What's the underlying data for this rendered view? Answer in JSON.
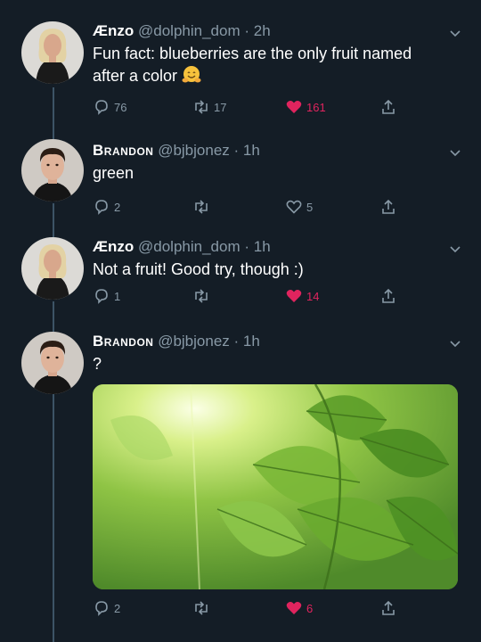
{
  "tweets": [
    {
      "name": "Ænzo",
      "handle": "@dolphin_dom",
      "time": "· 2h",
      "text_a": "Fun fact: blueberries are the only fruit named",
      "text_b": "after a color",
      "emoji": "hugging-face-emoji",
      "replies": "76",
      "retweets": "17",
      "likes": "161",
      "liked": true
    },
    {
      "name": "Brandon",
      "handle": "@bjbjonez",
      "time": "· 1h",
      "text": "green",
      "replies": "2",
      "retweets": "",
      "likes": "5",
      "liked": false
    },
    {
      "name": "Ænzo",
      "handle": "@dolphin_dom",
      "time": "· 1h",
      "text": "Not a fruit! Good try, though :)",
      "replies": "1",
      "retweets": "",
      "likes": "14",
      "liked": true
    },
    {
      "name": "Brandon",
      "handle": "@bjbjonez",
      "time": "· 1h",
      "text": "?",
      "media": "sunlit-green-leaves-photo",
      "replies": "2",
      "retweets": "",
      "likes": "6",
      "liked": true
    }
  ],
  "colors": {
    "background": "#141d26",
    "secondary_text": "#8899a6",
    "like_red": "#e0245e",
    "thread_line": "#3d5466"
  }
}
